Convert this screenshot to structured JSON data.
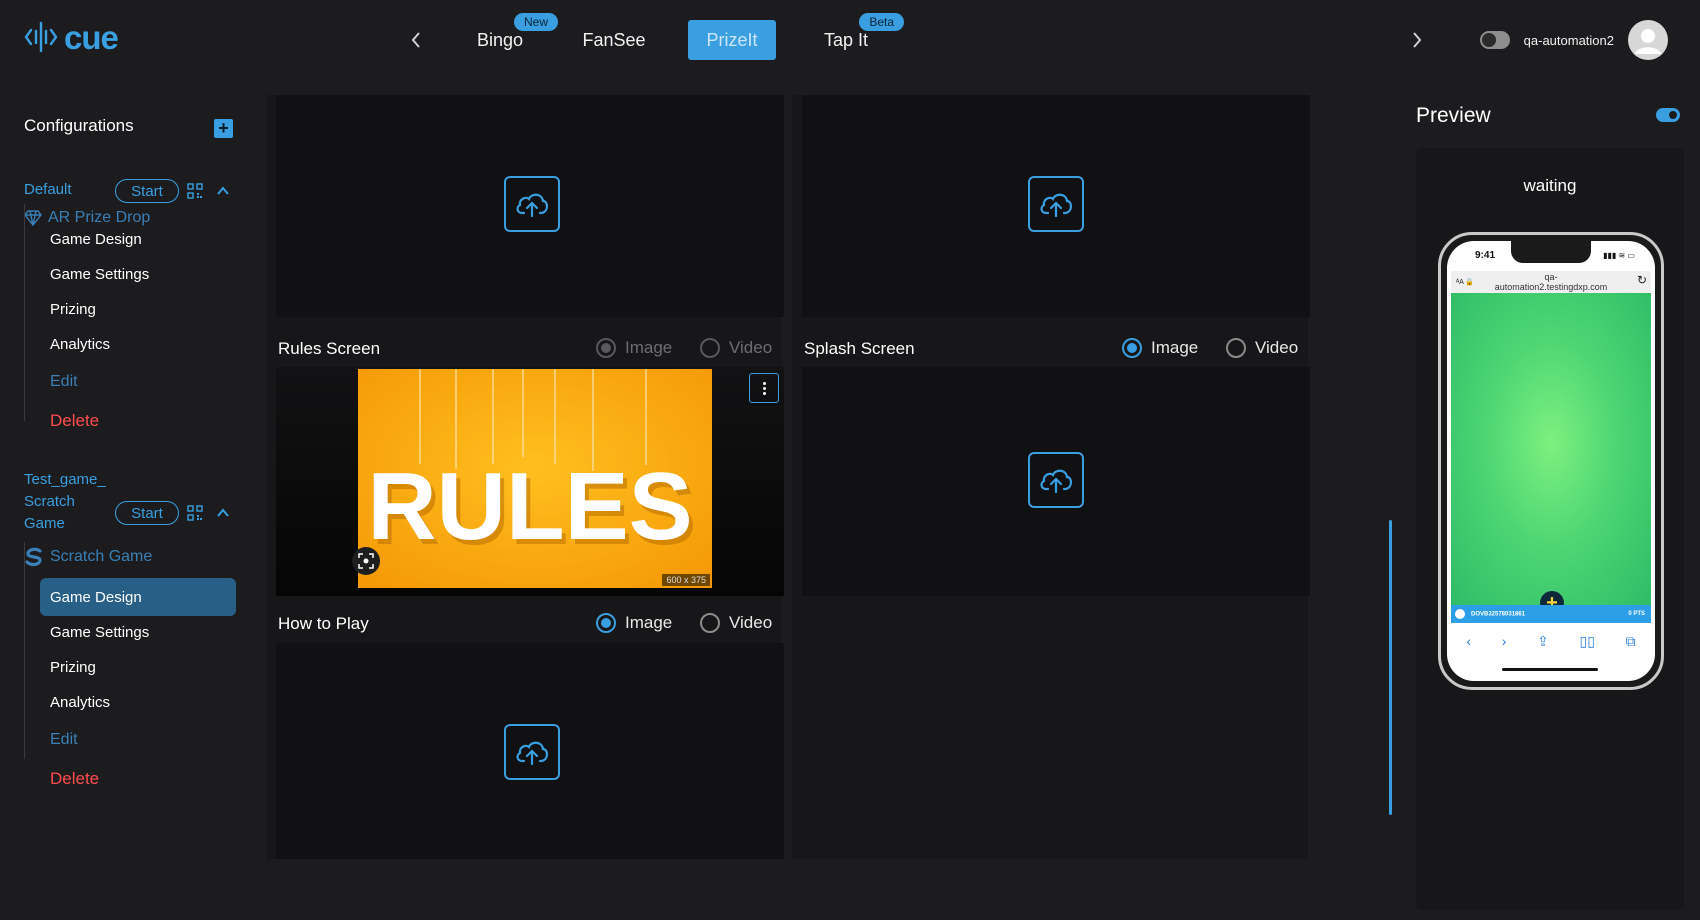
{
  "app": {
    "logo_text": "cue"
  },
  "nav": {
    "tabs": [
      {
        "label": "Bingo",
        "badge": "New"
      },
      {
        "label": "FanSee",
        "badge": ""
      },
      {
        "label": "PrizeIt",
        "badge": "",
        "active": true
      },
      {
        "label": "Tap It",
        "badge": "Beta"
      }
    ]
  },
  "user": {
    "name": "qa-automation2"
  },
  "sidebar": {
    "title": "Configurations",
    "configs": [
      {
        "name": "Default",
        "start_label": "Start",
        "game_type": "AR Prize Drop",
        "items": [
          "Game Design",
          "Game Settings",
          "Prizing",
          "Analytics",
          "Edit",
          "Delete"
        ]
      },
      {
        "name": "Test_game_\nScratch\nGame",
        "name_lines": [
          "Test_game_",
          "Scratch",
          "Game"
        ],
        "start_label": "Start",
        "game_type": "Scratch Game",
        "items": [
          "Game Design",
          "Game Settings",
          "Prizing",
          "Analytics",
          "Edit",
          "Delete"
        ],
        "active_item": "Game Design"
      }
    ]
  },
  "main": {
    "sections": {
      "rules": {
        "label": "Rules Screen",
        "image_label": "Image",
        "video_label": "Video",
        "selected": "Image",
        "image_text": "RULES",
        "image_size": "600 x 375"
      },
      "splash": {
        "label": "Splash Screen",
        "image_label": "Image",
        "video_label": "Video",
        "selected": "Image"
      },
      "how_to_play": {
        "label": "How to Play",
        "image_label": "Image",
        "video_label": "Video",
        "selected": "Image"
      }
    }
  },
  "preview": {
    "title": "Preview",
    "status": "waiting",
    "phone": {
      "time": "9:41",
      "url_line1": "qa-",
      "url_line2": "automation2.testingdxp.com",
      "strip_left": "DOVB32578031861",
      "strip_right": "0 PTS"
    }
  },
  "colors": {
    "accent": "#3a9fe0",
    "danger": "#ff4d4d",
    "bg": "#141417",
    "panel": "#1c1c1f"
  }
}
